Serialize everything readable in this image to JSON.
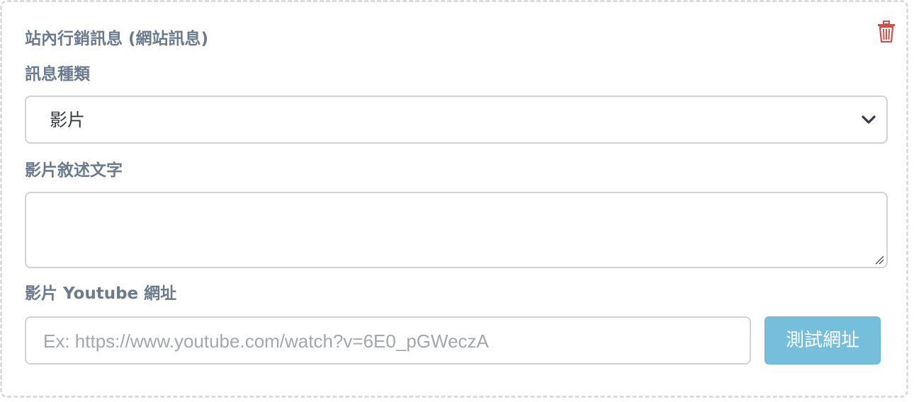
{
  "card": {
    "title": "站內行銷訊息 (網站訊息)"
  },
  "icons": {
    "delete": "trash-icon",
    "select_arrow": "chevron-down-icon",
    "resize": "resize-handle-icon"
  },
  "colors": {
    "label": "#6b7b8d",
    "delete_icon": "#c9534a",
    "button_bg": "#75bedc",
    "border_dashed": "#dcdcdc"
  },
  "message_type": {
    "label": "訊息種類",
    "selected": "影片"
  },
  "video_description": {
    "label": "影片敘述文字",
    "value": ""
  },
  "youtube_url": {
    "label": "影片 Youtube 網址",
    "value": "",
    "placeholder": "Ex: https://www.youtube.com/watch?v=6E0_pGWeczA",
    "test_button_label": "測試網址"
  }
}
